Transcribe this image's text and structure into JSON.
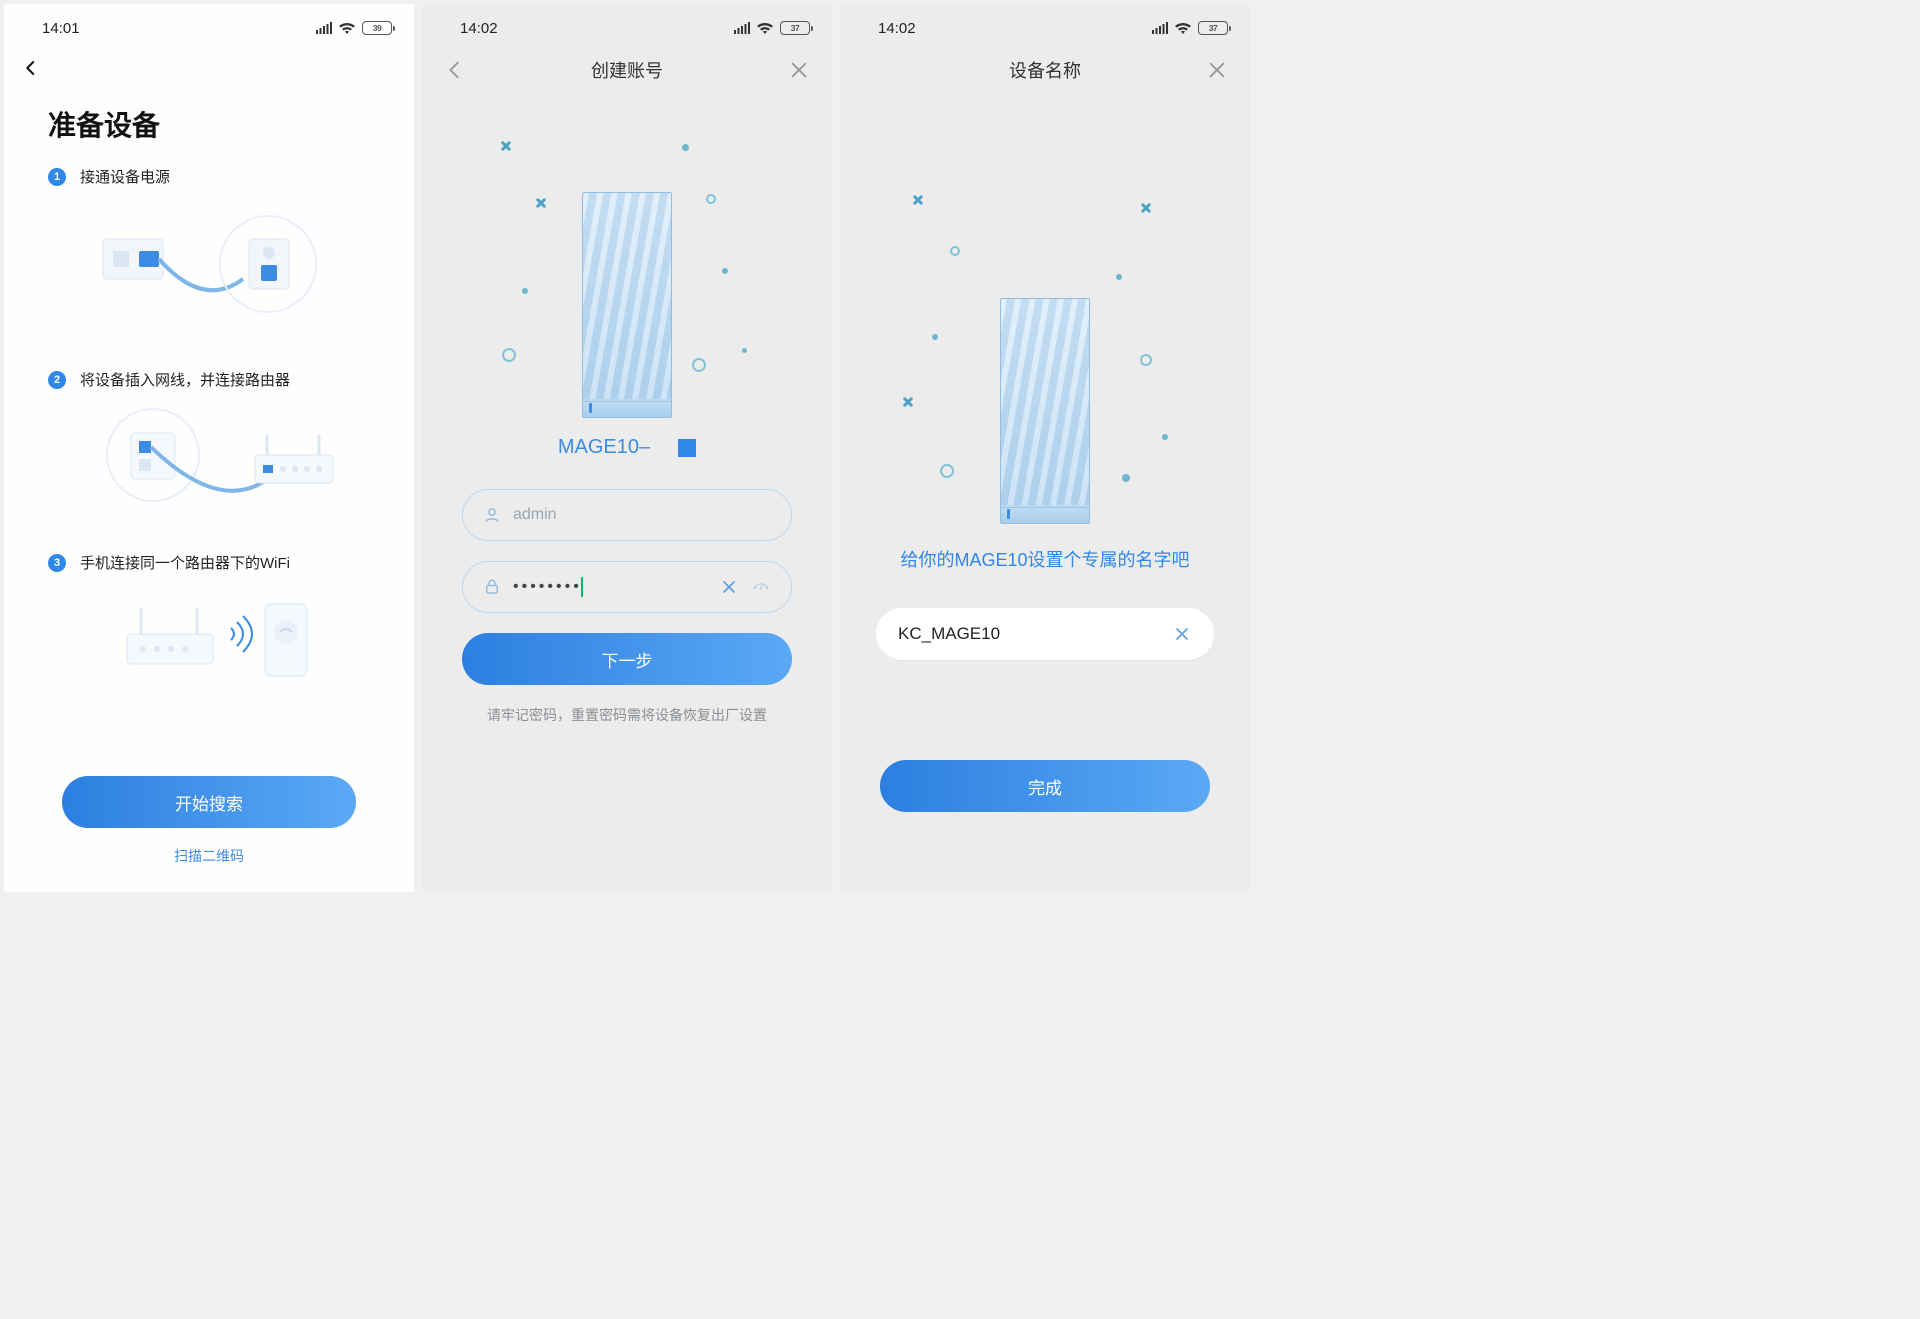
{
  "screen1": {
    "status": {
      "time": "14:01",
      "battery": "39"
    },
    "title": "准备设备",
    "steps": [
      {
        "num": "1",
        "text": "接通设备电源"
      },
      {
        "num": "2",
        "text": "将设备插入网线，并连接路由器"
      },
      {
        "num": "3",
        "text": "手机连接同一个路由器下的WiFi"
      }
    ],
    "start_button": "开始搜索",
    "scan_link": "扫描二维码"
  },
  "screen2": {
    "status": {
      "time": "14:02",
      "battery": "37"
    },
    "title": "创建账号",
    "device_label": "MAGE10– ",
    "username_value": "admin",
    "password_masked": "••••••••",
    "next_button": "下一步",
    "hint": "请牢记密码，重置密码需将设备恢复出厂设置"
  },
  "screen3": {
    "status": {
      "time": "14:02",
      "battery": "37"
    },
    "title": "设备名称",
    "message": "给你的MAGE10设置个专属的名字吧",
    "name_value": "KC_MAGE10",
    "done_button": "完成"
  }
}
